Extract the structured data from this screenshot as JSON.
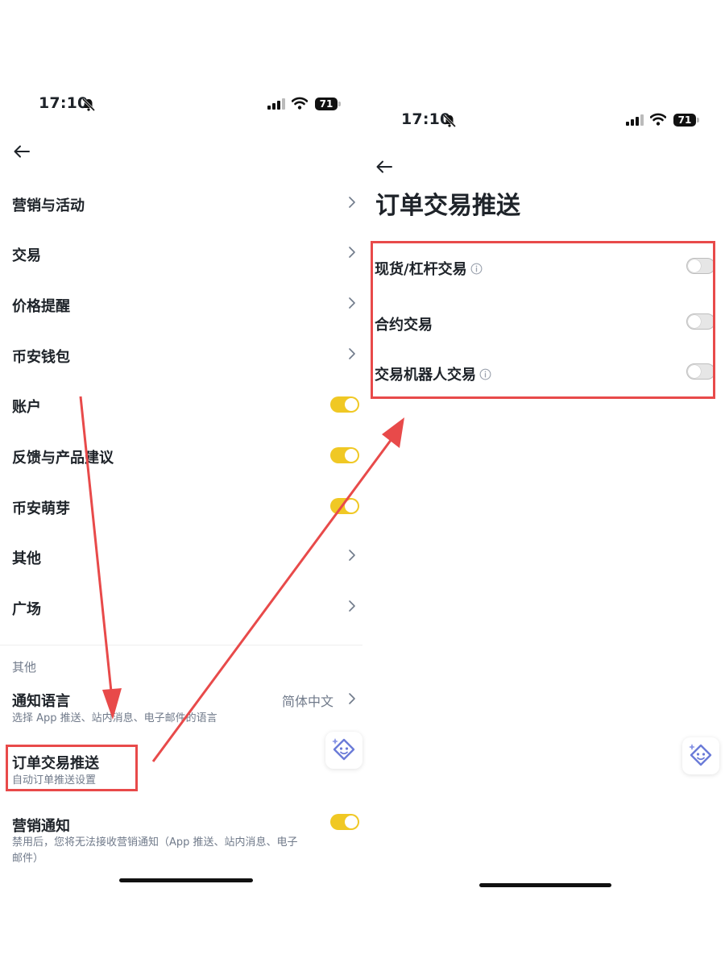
{
  "left": {
    "status": {
      "time": "17:10",
      "battery": "71"
    },
    "menu": [
      {
        "label": "营销与活动",
        "control": "chevron"
      },
      {
        "label": "交易",
        "control": "chevron"
      },
      {
        "label": "价格提醒",
        "control": "chevron"
      },
      {
        "label": "币安钱包",
        "control": "chevron"
      },
      {
        "label": "账户",
        "control": "toggle-on"
      },
      {
        "label": "反馈与产品建议",
        "control": "toggle-on"
      },
      {
        "label": "币安萌芽",
        "control": "toggle-on"
      },
      {
        "label": "其他",
        "control": "chevron"
      },
      {
        "label": "广场",
        "control": "chevron"
      }
    ],
    "section_title": "其他",
    "language": {
      "title": "通知语言",
      "value": "简体中文",
      "description": "选择 App 推送、站内消息、电子邮件的语言"
    },
    "order_push": {
      "title": "订单交易推送",
      "description": "自动订单推送设置"
    },
    "marketing": {
      "title": "营销通知",
      "description_line1": "禁用后，您将无法接收营销通知（App 推送、站内消息、电子",
      "description_line2": "邮件）",
      "enabled": true
    }
  },
  "right": {
    "status": {
      "time": "17:10",
      "battery": "71"
    },
    "title": "订单交易推送",
    "options": [
      {
        "label": "现货/杠杆交易",
        "info": true,
        "enabled": false
      },
      {
        "label": "合约交易",
        "info": false,
        "enabled": false
      },
      {
        "label": "交易机器人交易",
        "info": true,
        "enabled": false
      }
    ]
  },
  "colors": {
    "toggle_on": "#f0c824",
    "toggle_off": "#e6e6e6",
    "annotation_red": "#e84a4a",
    "text_primary": "#1e2329",
    "text_secondary": "#707a8a"
  },
  "icons": {
    "back": "arrow-left-icon",
    "chevron": "chevron-right-icon",
    "info": "info-circle-icon",
    "assistant": "ai-assistant-icon"
  }
}
